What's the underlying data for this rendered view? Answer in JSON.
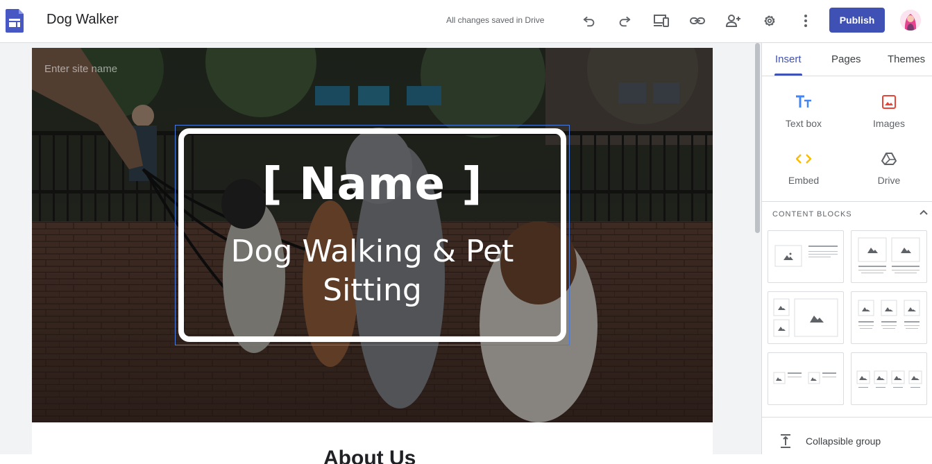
{
  "app": {
    "doc_title": "Dog Walker",
    "save_status": "All changes saved in Drive",
    "publish_label": "Publish",
    "accent_color": "#3f51b5",
    "toolbar_icons": [
      "undo-icon",
      "redo-icon",
      "preview-devices-icon",
      "link-icon",
      "share-icon",
      "settings-icon",
      "more-vert-icon"
    ]
  },
  "site": {
    "name_placeholder": "Enter site name",
    "hero_title": "[ Name ]",
    "hero_subtitle": "Dog Walking & Pet Sitting",
    "section_heading": "About Us"
  },
  "panel": {
    "tabs": [
      {
        "label": "Insert",
        "active": true
      },
      {
        "label": "Pages",
        "active": false
      },
      {
        "label": "Themes",
        "active": false
      }
    ],
    "insert_items": [
      {
        "label": "Text box",
        "icon": "text-box-icon"
      },
      {
        "label": "Images",
        "icon": "image-icon"
      },
      {
        "label": "Embed",
        "icon": "embed-icon"
      },
      {
        "label": "Drive",
        "icon": "drive-icon"
      }
    ],
    "content_blocks_heading": "CONTENT BLOCKS",
    "collapsible_group_label": "Collapsible group"
  }
}
